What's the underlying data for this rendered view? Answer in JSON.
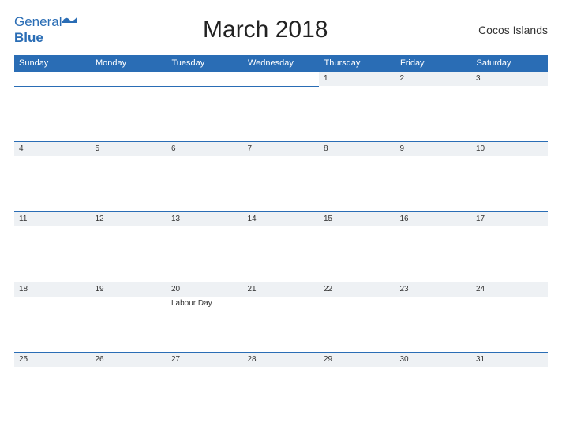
{
  "header": {
    "logo_word1": "General",
    "logo_word2": "Blue",
    "title": "March 2018",
    "region": "Cocos Islands"
  },
  "days_of_week": [
    "Sunday",
    "Monday",
    "Tuesday",
    "Wednesday",
    "Thursday",
    "Friday",
    "Saturday"
  ],
  "weeks": [
    [
      {
        "num": "",
        "event": ""
      },
      {
        "num": "",
        "event": ""
      },
      {
        "num": "",
        "event": ""
      },
      {
        "num": "",
        "event": ""
      },
      {
        "num": "1",
        "event": ""
      },
      {
        "num": "2",
        "event": ""
      },
      {
        "num": "3",
        "event": ""
      }
    ],
    [
      {
        "num": "4",
        "event": ""
      },
      {
        "num": "5",
        "event": ""
      },
      {
        "num": "6",
        "event": ""
      },
      {
        "num": "7",
        "event": ""
      },
      {
        "num": "8",
        "event": ""
      },
      {
        "num": "9",
        "event": ""
      },
      {
        "num": "10",
        "event": ""
      }
    ],
    [
      {
        "num": "11",
        "event": ""
      },
      {
        "num": "12",
        "event": ""
      },
      {
        "num": "13",
        "event": ""
      },
      {
        "num": "14",
        "event": ""
      },
      {
        "num": "15",
        "event": ""
      },
      {
        "num": "16",
        "event": ""
      },
      {
        "num": "17",
        "event": ""
      }
    ],
    [
      {
        "num": "18",
        "event": ""
      },
      {
        "num": "19",
        "event": ""
      },
      {
        "num": "20",
        "event": "Labour Day"
      },
      {
        "num": "21",
        "event": ""
      },
      {
        "num": "22",
        "event": ""
      },
      {
        "num": "23",
        "event": ""
      },
      {
        "num": "24",
        "event": ""
      }
    ],
    [
      {
        "num": "25",
        "event": ""
      },
      {
        "num": "26",
        "event": ""
      },
      {
        "num": "27",
        "event": ""
      },
      {
        "num": "28",
        "event": ""
      },
      {
        "num": "29",
        "event": ""
      },
      {
        "num": "30",
        "event": ""
      },
      {
        "num": "31",
        "event": ""
      }
    ]
  ]
}
